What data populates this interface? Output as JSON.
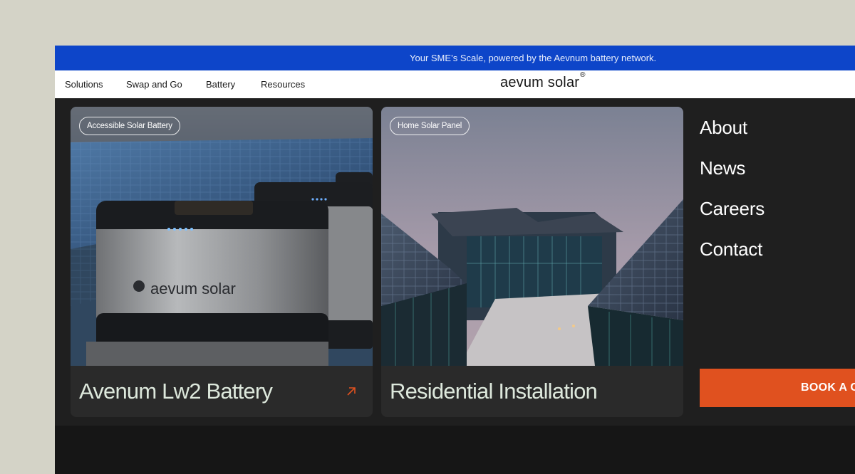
{
  "announcement": "Your SME’s Scale, powered by the Aevnum battery network.",
  "nav": {
    "links": [
      "Solutions",
      "Swap and Go",
      "Battery",
      "Resources"
    ],
    "logo": "aevum solar",
    "logo_mark": "®"
  },
  "cards": [
    {
      "badge": "Accessible Solar Battery",
      "title": "Avenum Lw2 Battery",
      "product_brand": "aevum solar",
      "icon": "arrow-up-right-icon"
    },
    {
      "badge": "Home Solar Panel",
      "title": "Residential Installation"
    }
  ],
  "side_menu": [
    "About",
    "News",
    "Careers",
    "Contact"
  ],
  "cta": "BOOK A C",
  "colors": {
    "announcement_bg": "#0d45c9",
    "dark_bg": "#1f1f1f",
    "accent": "#e0511f",
    "card_title": "#dde8dc"
  }
}
